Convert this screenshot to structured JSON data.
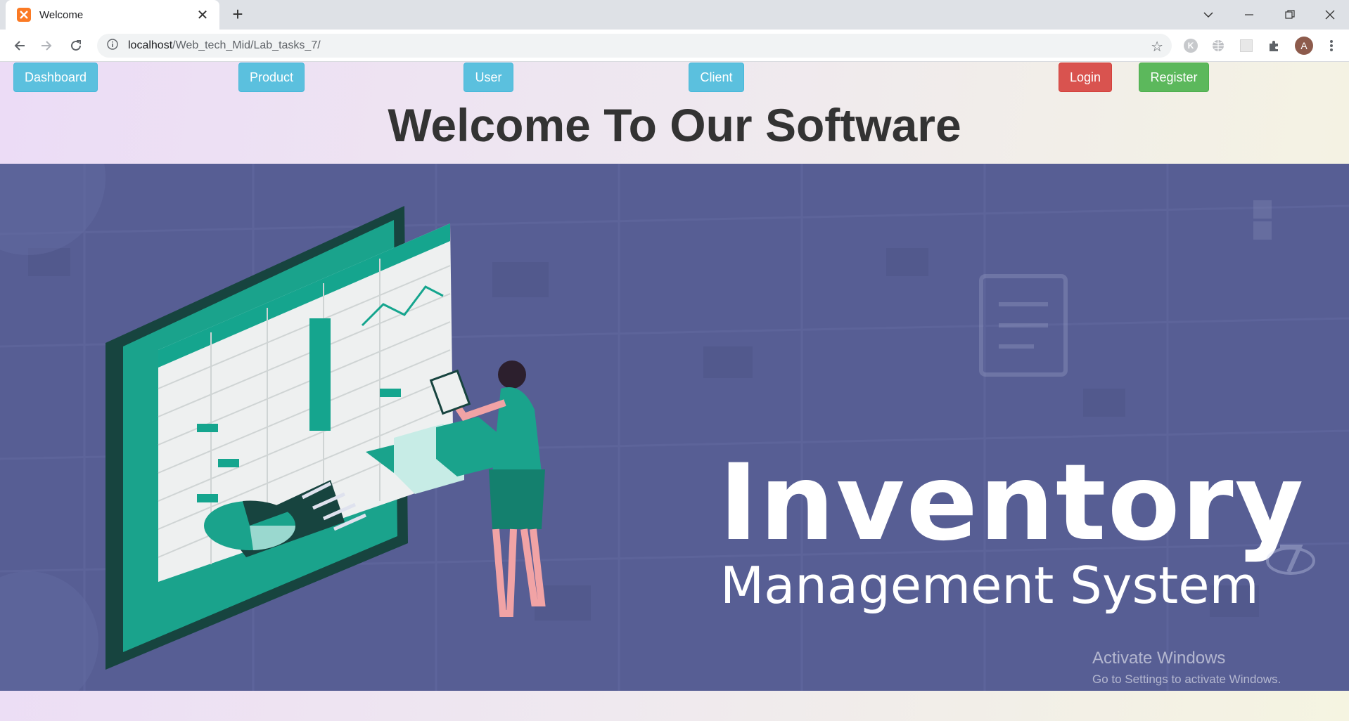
{
  "browser": {
    "tab": {
      "title": "Welcome",
      "close_glyph": "✕"
    },
    "new_tab_glyph": "+",
    "window_controls": [
      "chevron-down",
      "minimize",
      "restore",
      "close"
    ],
    "url": {
      "host": "localhost",
      "path": "/Web_tech_Mid/Lab_tasks_7/"
    },
    "profile_initial": "A",
    "extension_k": "K"
  },
  "page": {
    "nav": {
      "dashboard": "Dashboard",
      "product": "Product",
      "user": "User",
      "client": "Client",
      "login": "Login",
      "register": "Register"
    },
    "heading": "Welcome To Our Software",
    "hero": {
      "title_line1": "Inventory",
      "title_line2": "Management System"
    }
  },
  "os_overlay": {
    "line1": "Activate Windows",
    "line2": "Go to Settings to activate Windows."
  },
  "colors": {
    "hero_bg": "#575e94",
    "btn_info": "#5bc0de",
    "btn_danger": "#d9534f",
    "btn_success": "#5cb85c",
    "teal": "#15a58e"
  }
}
